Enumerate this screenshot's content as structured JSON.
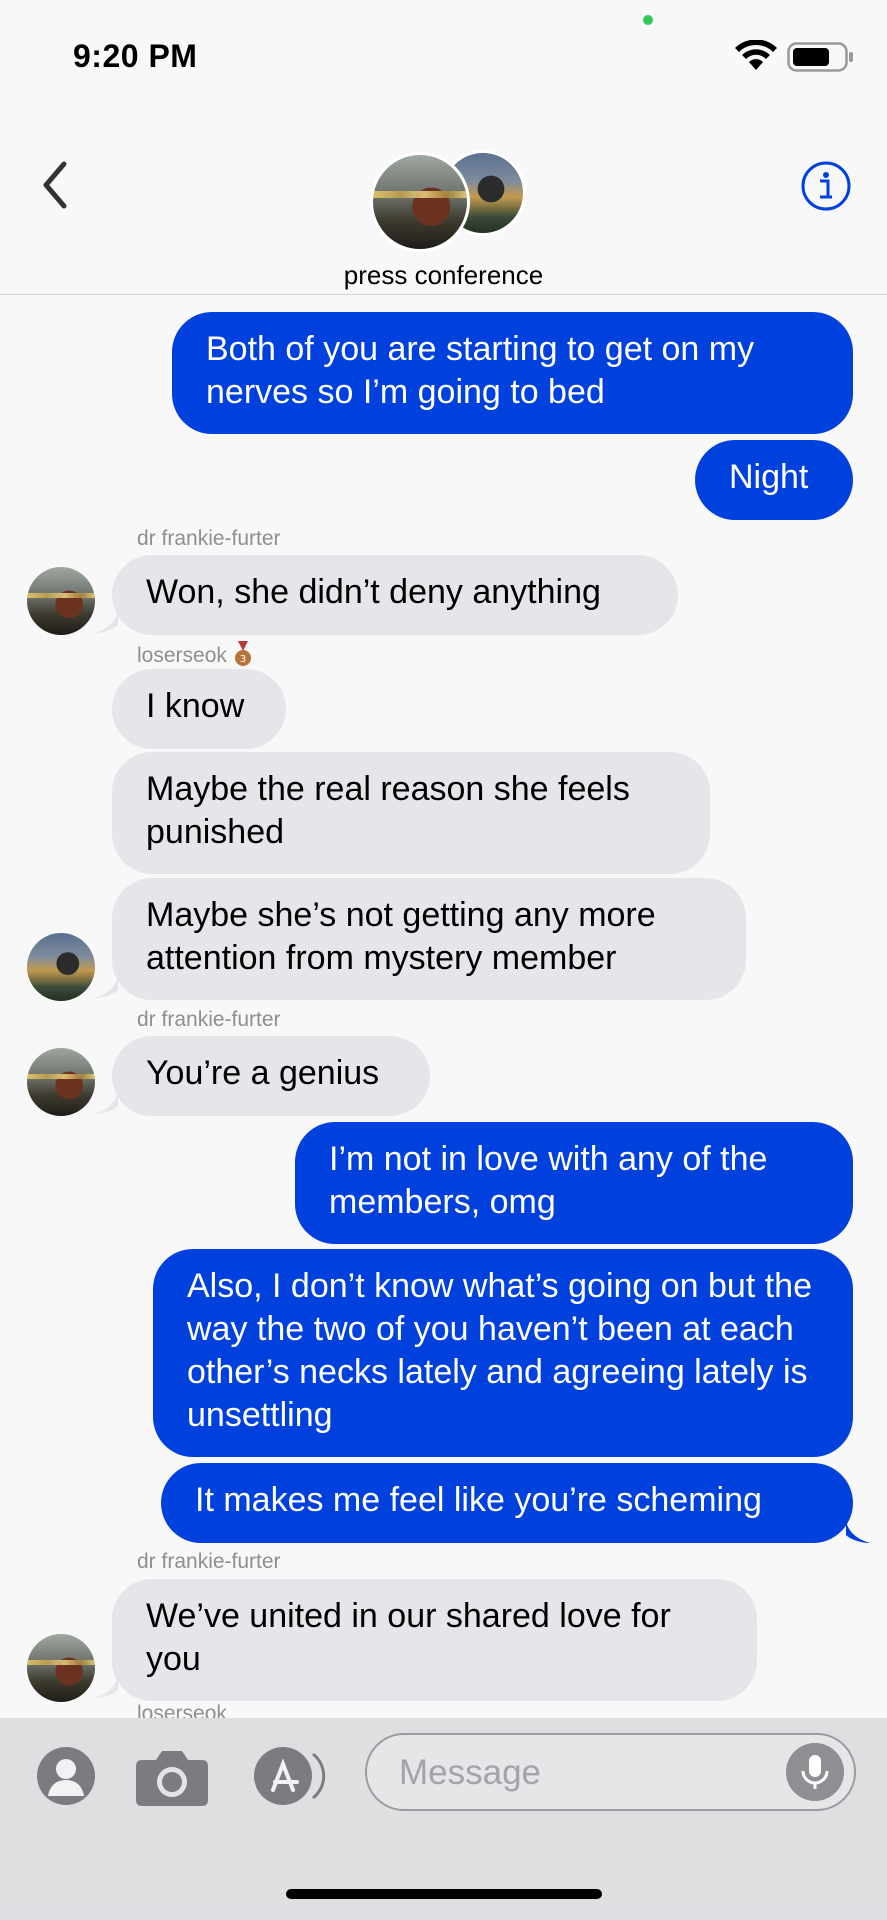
{
  "status_bar": {
    "time": "9:20 PM"
  },
  "header": {
    "title": "press conference"
  },
  "messages": [
    {
      "sender": "",
      "text": "Both of you are starting to get on my nerves so I’m going to bed"
    },
    {
      "sender": "",
      "text": "Night"
    },
    {
      "sender": "dr frankie-furter",
      "text": "Won, she didn’t deny anything"
    },
    {
      "sender": "loserseok",
      "text": "I know"
    },
    {
      "sender": "",
      "text": "Maybe the real reason she feels punished"
    },
    {
      "sender": "",
      "text": "Maybe she’s not getting any more attention from mystery member"
    },
    {
      "sender": "dr frankie-furter",
      "text": "You’re a genius"
    },
    {
      "sender": "",
      "text": "I’m not in love with any of the members, omg"
    },
    {
      "sender": "",
      "text": "Also, I don’t know what’s going on but the way the two of you haven’t been at each other’s necks lately and agreeing lately is unsettling"
    },
    {
      "sender": "",
      "text": "It makes me feel like you’re scheming"
    },
    {
      "sender": "dr frankie-furter",
      "text": "We’ve united in our shared love for you"
    },
    {
      "sender": "loserseok",
      "text": ""
    }
  ],
  "compose": {
    "placeholder": "Message"
  },
  "colors": {
    "outgoing": "#0040dd",
    "incoming": "#e5e5ea",
    "accent": "#0040dd"
  },
  "icons": [
    "back-chevron-icon",
    "info-icon",
    "wifi-icon",
    "battery-icon",
    "contact-icon",
    "camera-icon",
    "app-store-icon",
    "microphone-icon",
    "medal-icon"
  ]
}
